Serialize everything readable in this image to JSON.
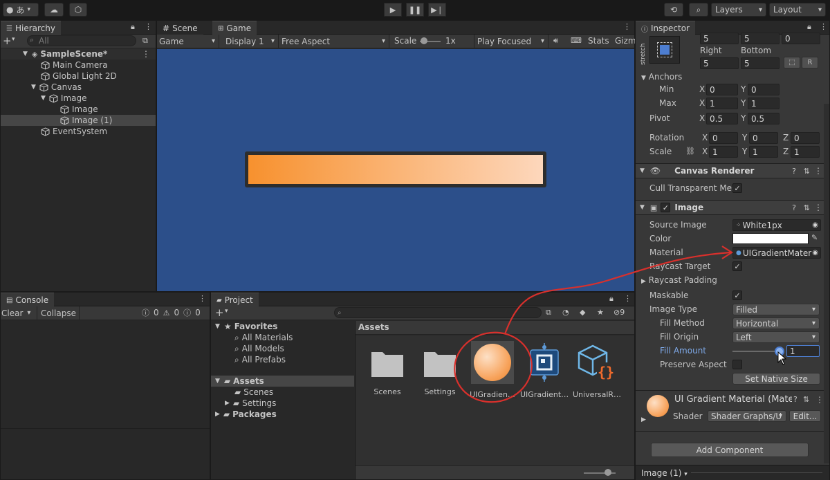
{
  "toolbar": {
    "account_label": "あ",
    "layers_label": "Layers",
    "layout_label": "Layout"
  },
  "hierarchy": {
    "tab_label": "Hierarchy",
    "search_placeholder": "All",
    "items": [
      {
        "label": "SampleScene*"
      },
      {
        "label": "Main Camera"
      },
      {
        "label": "Global Light 2D"
      },
      {
        "label": "Canvas"
      },
      {
        "label": "Image"
      },
      {
        "label": "Image"
      },
      {
        "label": "Image (1)"
      },
      {
        "label": "EventSystem"
      }
    ]
  },
  "view": {
    "scene_tab": "Scene",
    "game_tab": "Game",
    "game_dropdown": "Game",
    "display_dropdown": "Display 1",
    "aspect_dropdown": "Free Aspect",
    "scale_label": "Scale",
    "scale_value": "1x",
    "play_mode_dropdown": "Play Focused",
    "stats_label": "Stats",
    "gizmos_label": "Gizm"
  },
  "console": {
    "tab_label": "Console",
    "clear_label": "Clear",
    "collapse_label": "Collapse",
    "info_count": "0",
    "warn_count": "0",
    "error_count": "0"
  },
  "project": {
    "tab_label": "Project",
    "hidden_count": "9",
    "favorites_label": "Favorites",
    "favorites": [
      "All Materials",
      "All Models",
      "All Prefabs"
    ],
    "assets_label": "Assets",
    "asset_folders": [
      "Scenes",
      "Settings"
    ],
    "packages_label": "Packages",
    "breadcrumb": "Assets",
    "assets": [
      {
        "name": "Scenes"
      },
      {
        "name": "Settings"
      },
      {
        "name": "UIGradien…"
      },
      {
        "name": "UIGradient…"
      },
      {
        "name": "UniversalR…"
      }
    ]
  },
  "inspector": {
    "tab_label": "Inspector",
    "stretch_label": "stretch",
    "top_values": [
      "5",
      "5",
      "0"
    ],
    "right_label": "Right",
    "bottom_label": "Bottom",
    "right_value": "5",
    "bottom_value": "5",
    "r_button": "R",
    "anchors_label": "Anchors",
    "min_label": "Min",
    "max_label": "Max",
    "anchor_min": {
      "x": "0",
      "y": "0"
    },
    "anchor_max": {
      "x": "1",
      "y": "1"
    },
    "pivot_label": "Pivot",
    "pivot": {
      "x": "0.5",
      "y": "0.5"
    },
    "rotation_label": "Rotation",
    "rotation": {
      "x": "0",
      "y": "0",
      "z": "0"
    },
    "scale_label": "Scale",
    "scale": {
      "x": "1",
      "y": "1",
      "z": "1"
    },
    "axis_x": "X",
    "axis_y": "Y",
    "axis_z": "Z",
    "canvas_renderer_label": "Canvas Renderer",
    "cull_label": "Cull Transparent Mes",
    "image_label": "Image",
    "source_image_label": "Source Image",
    "source_image_value": "White1px",
    "color_label": "Color",
    "material_label": "Material",
    "material_value": "UIGradientMater",
    "raycast_target_label": "Raycast Target",
    "raycast_padding_label": "Raycast Padding",
    "maskable_label": "Maskable",
    "image_type_label": "Image Type",
    "image_type_value": "Filled",
    "fill_method_label": "Fill Method",
    "fill_method_value": "Horizontal",
    "fill_origin_label": "Fill Origin",
    "fill_origin_value": "Left",
    "fill_amount_label": "Fill Amount",
    "fill_amount_value": "1",
    "preserve_aspect_label": "Preserve Aspect",
    "set_native_size_label": "Set Native Size",
    "material_title": "UI Gradient Material (Mate",
    "shader_label": "Shader",
    "shader_value": "Shader Graphs/U",
    "edit_label": "Edit...",
    "add_component_label": "Add Component",
    "footer_label": "Image (1)",
    "check_mark": "✓"
  },
  "colors": {
    "accent": "#4d7ed1",
    "game_bg": "#2c4f8a",
    "gradient_start": "#f7912e",
    "gradient_end": "#fdd7bc",
    "annotation_red": "#d9302c"
  }
}
